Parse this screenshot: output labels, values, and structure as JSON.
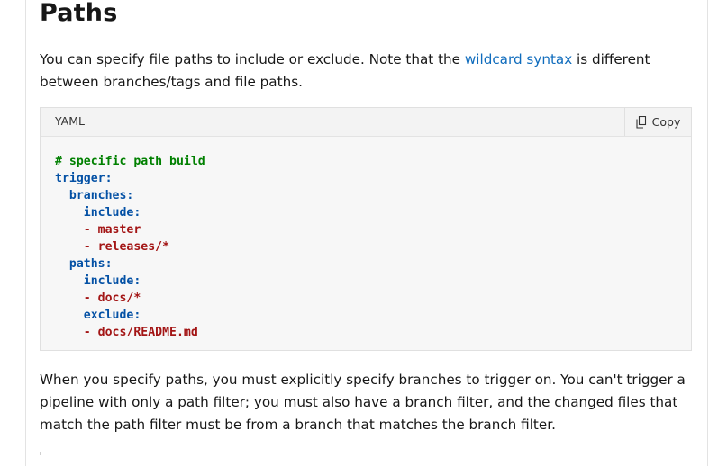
{
  "heading": "Paths",
  "intro": {
    "before": "You can specify file paths to include or exclude. Note that the ",
    "link": "wildcard syntax",
    "after": " is different between branches/tags and file paths."
  },
  "code_block": {
    "language": "YAML",
    "copy_label": "Copy",
    "lines": [
      {
        "indent": "",
        "text": "# specific path build",
        "kind": "comment"
      },
      {
        "indent": "",
        "text": "trigger:",
        "kind": "key"
      },
      {
        "indent": "  ",
        "text": "branches:",
        "kind": "key"
      },
      {
        "indent": "    ",
        "text": "include:",
        "kind": "key"
      },
      {
        "indent": "    ",
        "text": "- master",
        "kind": "string"
      },
      {
        "indent": "    ",
        "text": "- releases/*",
        "kind": "string"
      },
      {
        "indent": "  ",
        "text": "paths:",
        "kind": "key"
      },
      {
        "indent": "    ",
        "text": "include:",
        "kind": "key"
      },
      {
        "indent": "    ",
        "text": "- docs/*",
        "kind": "string"
      },
      {
        "indent": "    ",
        "text": "exclude:",
        "kind": "key"
      },
      {
        "indent": "    ",
        "text": "- docs/README.md",
        "kind": "string"
      }
    ]
  },
  "note": "When you specify paths, you must explicitly specify branches to trigger on. You can't trigger a pipeline with only a path filter; you must also have a branch filter, and the changed files that match the path filter must be from a branch that matches the branch filter.",
  "icons": {
    "copy": "copy-icon"
  }
}
